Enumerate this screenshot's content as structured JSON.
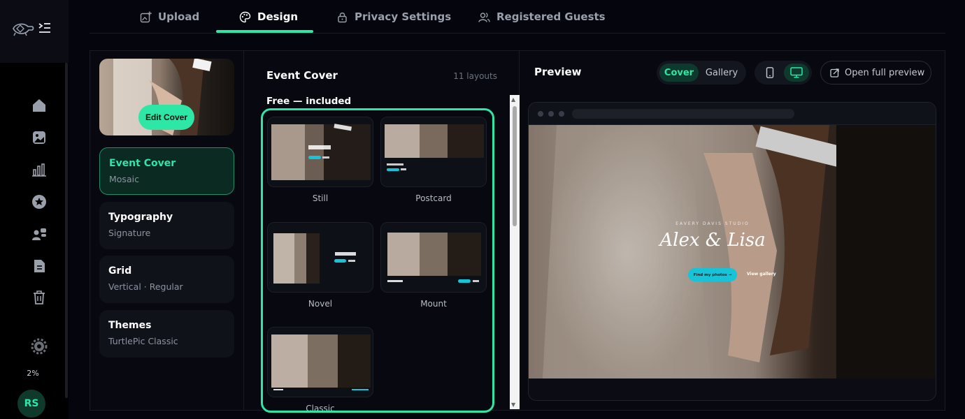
{
  "sidebar": {
    "logo_icon": "turtle-logo-icon",
    "collapse_icon": "collapse-menu-icon",
    "nav_icons": [
      "home-icon",
      "image-icon",
      "chart-icon",
      "star-icon",
      "users-icon",
      "document-icon",
      "trash-icon",
      "settings-icon"
    ],
    "storage_label": "2%",
    "avatar_initials": "RS"
  },
  "tabs": [
    {
      "label": "Upload",
      "icon": "upload-image-icon"
    },
    {
      "label": "Design",
      "icon": "palette-icon"
    },
    {
      "label": "Privacy Settings",
      "icon": "lock-icon"
    },
    {
      "label": "Registered Guests",
      "icon": "guests-icon"
    }
  ],
  "active_tab": "Design",
  "cover": {
    "edit_label": "Edit Cover"
  },
  "settings_cards": [
    {
      "title": "Event Cover",
      "value": "Mosaic"
    },
    {
      "title": "Typography",
      "value": "Signature"
    },
    {
      "title": "Grid",
      "value": "Vertical · Regular"
    },
    {
      "title": "Themes",
      "value": "TurtlePic Classic"
    }
  ],
  "layouts": {
    "title": "Event Cover",
    "count": "11 layouts",
    "section_label": "Free — included",
    "items": [
      "Still",
      "Postcard",
      "Novel",
      "Mount",
      "Classic"
    ]
  },
  "preview": {
    "title": "Preview",
    "mode_tabs": [
      "Cover",
      "Gallery"
    ],
    "active_mode": "Cover",
    "device_icons": [
      "mobile-icon",
      "desktop-icon"
    ],
    "active_device": "desktop",
    "open_full_label": "Open full preview",
    "studio_name": "EAVERY DAVIS STUDIO",
    "couple_names": "Alex & Lisa",
    "find_button": "Find my photos →",
    "gallery_link": "View gallery"
  },
  "colors": {
    "accent": "#2ee6a6",
    "preview_button": "#17c3d6",
    "background": "#05060d"
  }
}
